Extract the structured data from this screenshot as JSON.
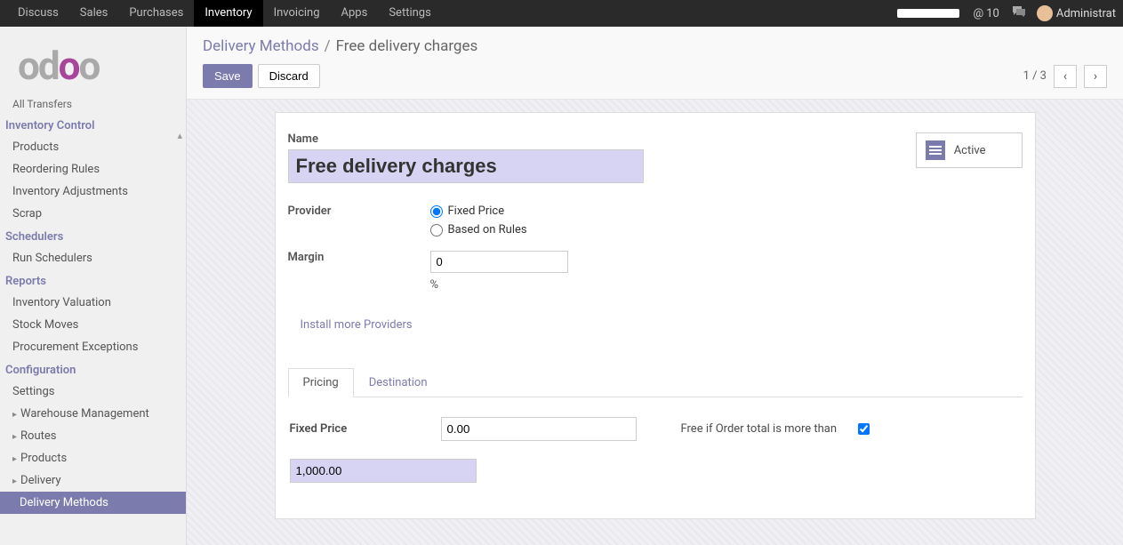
{
  "topbar": {
    "items": [
      "Discuss",
      "Sales",
      "Purchases",
      "Inventory",
      "Invoicing",
      "Apps",
      "Settings"
    ],
    "active_index": 3,
    "notif_count": "10",
    "user_name": "Administrat"
  },
  "sidebar": {
    "cut_item": "All Transfers",
    "sections": [
      {
        "title": "Inventory Control",
        "items": [
          "Products",
          "Reordering Rules",
          "Inventory Adjustments",
          "Scrap"
        ]
      },
      {
        "title": "Schedulers",
        "items": [
          "Run Schedulers"
        ]
      },
      {
        "title": "Reports",
        "items": [
          "Inventory Valuation",
          "Stock Moves",
          "Procurement Exceptions"
        ]
      },
      {
        "title": "Configuration",
        "items": [
          "Settings",
          "Warehouse Management",
          "Routes",
          "Products",
          "Delivery",
          "Delivery Methods"
        ]
      }
    ]
  },
  "breadcrumb": {
    "parent": "Delivery Methods",
    "current": "Free delivery charges"
  },
  "buttons": {
    "save": "Save",
    "discard": "Discard"
  },
  "pager": {
    "text": "1 / 3"
  },
  "form": {
    "name_label": "Name",
    "name_value": "Free delivery charges",
    "active_label": "Active",
    "provider_label": "Provider",
    "provider_opt1": "Fixed Price",
    "provider_opt2": "Based on Rules",
    "margin_label": "Margin",
    "margin_value": "0",
    "margin_unit": "%",
    "install_link": "Install more Providers",
    "tabs": {
      "pricing": "Pricing",
      "destination": "Destination"
    },
    "pricing": {
      "fixed_label": "Fixed Price",
      "fixed_value": "0.00",
      "free_label": "Free if Order total is more than",
      "free_checked": true,
      "free_value": "1,000.00"
    }
  }
}
